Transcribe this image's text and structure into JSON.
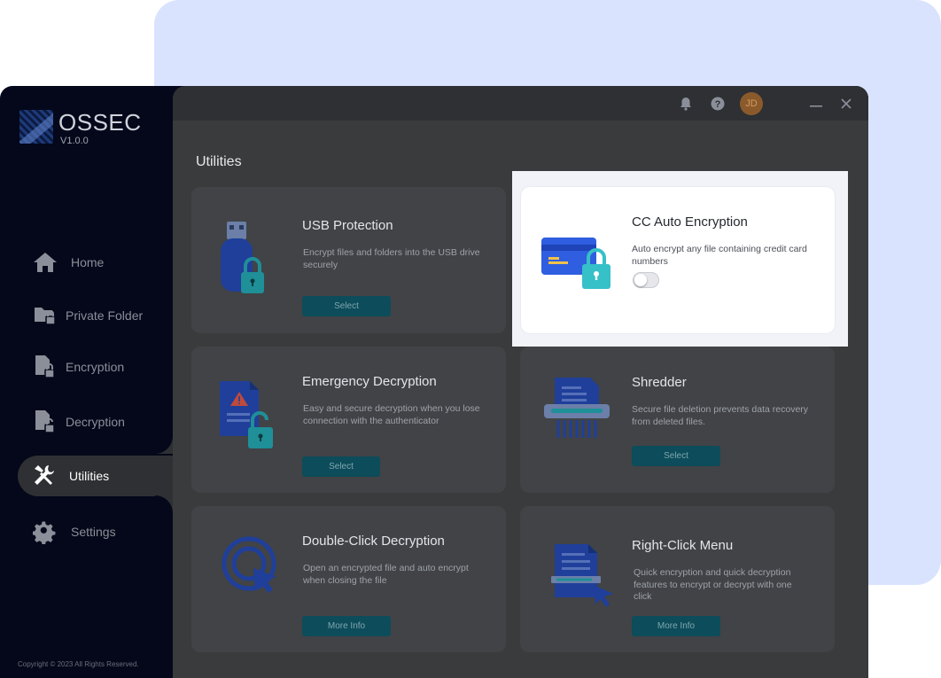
{
  "app": {
    "brand": "OSSEC",
    "version": "V1.0.0"
  },
  "topbar": {
    "avatar_initials": "JD",
    "icons": [
      "bell-icon",
      "help-icon",
      "minimize-icon",
      "close-icon"
    ]
  },
  "sidebar": {
    "items": [
      {
        "label": "Home",
        "icon": "home-icon"
      },
      {
        "label": "Private Folder",
        "icon": "folder-lock-icon"
      },
      {
        "label": "Encryption",
        "icon": "file-lock-icon"
      },
      {
        "label": "Decryption",
        "icon": "file-unlock-icon"
      },
      {
        "label": "Utilities",
        "icon": "tools-icon",
        "active": true
      },
      {
        "label": "Settings",
        "icon": "gear-icon"
      }
    ],
    "copyright": "Copyright © 2023 All Rights Reserved."
  },
  "main": {
    "title": "Utilities",
    "cards": [
      {
        "title": "USB Protection",
        "desc": "Encrypt files and folders into the USB drive securely",
        "button": "Select",
        "icon": "usb-lock-icon"
      },
      {
        "title": "CC Auto Encryption",
        "desc": "Auto encrypt any file containing credit card numbers",
        "toggle": false,
        "icon": "credit-card-lock-icon"
      },
      {
        "title": "Emergency Decryption",
        "desc": "Easy and secure decryption when you lose connection with the authenticator",
        "button": "Select",
        "icon": "document-warning-icon"
      },
      {
        "title": "Shredder",
        "desc": "Secure file deletion prevents data recovery from deleted files.",
        "button": "Select",
        "icon": "shredder-icon"
      },
      {
        "title": "Double-Click Decryption",
        "desc": "Open an encrypted file and auto encrypt when closing the file",
        "button": "More Info",
        "icon": "double-click-icon"
      },
      {
        "title": "Right-Click Menu",
        "desc": "Quick encryption and quick decryption features to encrypt or decrypt with one click",
        "button": "More Info",
        "icon": "context-menu-icon"
      }
    ]
  },
  "colors": {
    "sidebar": "#04081a",
    "content": "#393b3d",
    "card": "#414346",
    "button": "#0d4c5a",
    "accent_blue": "#2f5ee0",
    "accent_teal": "#36c0c8",
    "background_panel": "#d9e3fe"
  }
}
